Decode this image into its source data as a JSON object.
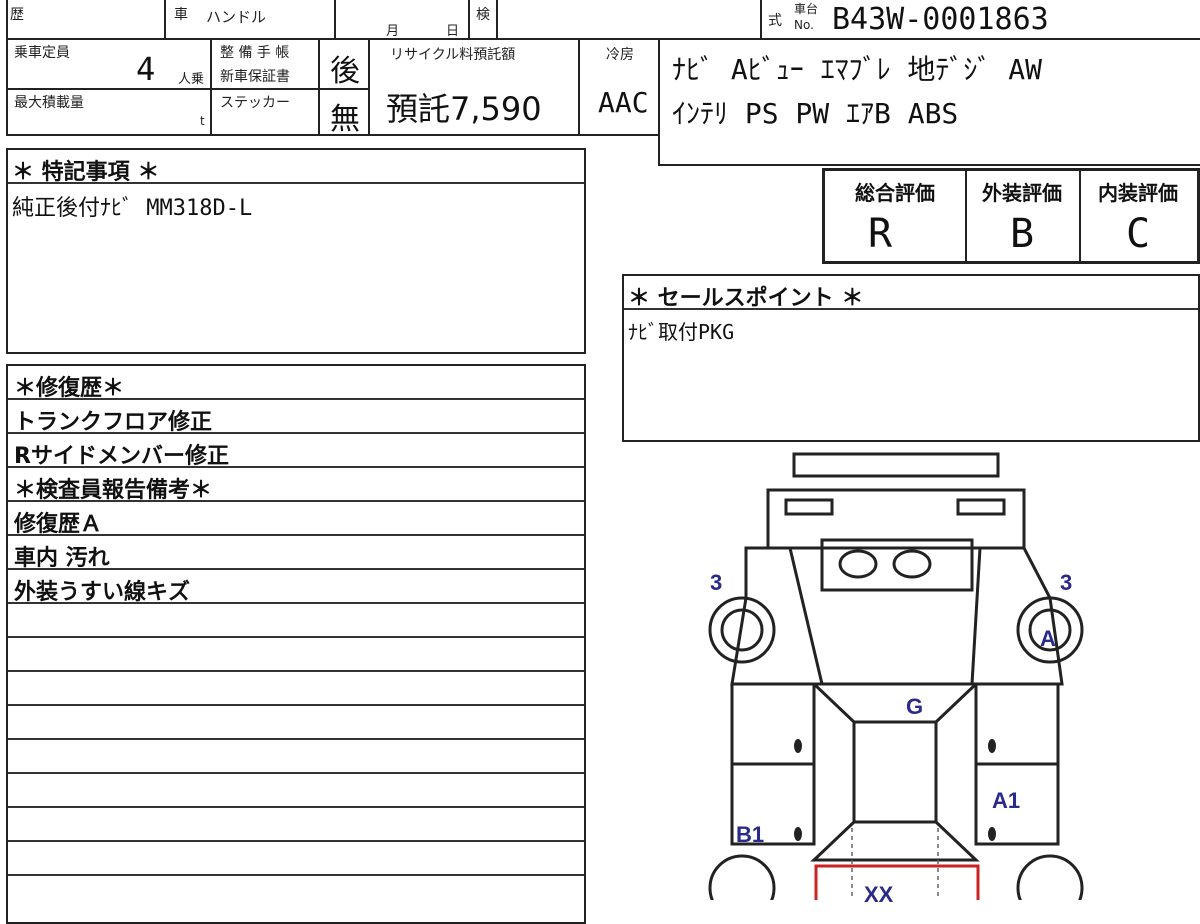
{
  "header": {
    "reki_label": "歴",
    "sha_label": "車",
    "handle_label": "ハンドル",
    "month_label": "月",
    "day_label": "日",
    "ken_label": "検",
    "shiki_label": "式",
    "chassis_label_top": "車台",
    "chassis_label_bottom": "No.",
    "chassis_no": "B43W-0001863"
  },
  "specs": {
    "capacity_label": "乗車定員",
    "capacity_value": "4",
    "capacity_unit": "人乗",
    "load_label": "最大積載量",
    "load_unit": "t",
    "maint_label_1": "整 備 手 帳",
    "maint_label_2": "新車保証書",
    "maint_value": "後",
    "sticker_label": "ステッカー",
    "sticker_value": "無",
    "recycle_label": "リサイクル料預託額",
    "recycle_value": "預託7,590",
    "ac_label": "冷房",
    "ac_value": "AAC",
    "equipment_line1": "ﾅﾋﾞ Aﾋﾞｭｰ ｴﾏﾌﾞﾚ 地ﾃﾞｼﾞ AW",
    "equipment_line2": "ｲﾝﾃﾘ PS PW ｴｱB ABS"
  },
  "special_notes": {
    "title": "＊ 特記事項 ＊",
    "text": "純正後付ﾅﾋﾞ MM318D-L"
  },
  "grades": {
    "overall_label": "総合評価",
    "exterior_label": "外装評価",
    "interior_label": "内装評価",
    "overall": "R",
    "exterior": "B",
    "interior": "C"
  },
  "sales_point": {
    "title": "＊ セールスポイント ＊",
    "text": "ﾅﾋﾞ取付PKG"
  },
  "history": {
    "rows": [
      "＊修復歴＊",
      "トランクフロア修正",
      "Rサイドメンバー修正",
      "＊検査員報告備考＊",
      "修復歴Ａ",
      "車内 汚れ",
      "外装うすい線キズ",
      "",
      "",
      "",
      "",
      "",
      "",
      "",
      "",
      ""
    ]
  },
  "diagram": {
    "marks": {
      "front_left": "3",
      "front_right": "3",
      "tire_right": "A",
      "roof": "G",
      "right_side": "A1",
      "left_side": "B1",
      "rear": "XX"
    }
  },
  "colors": {
    "ink": "#111111",
    "mark_blue": "#2a2a8a",
    "repair_red": "#cc2222"
  }
}
